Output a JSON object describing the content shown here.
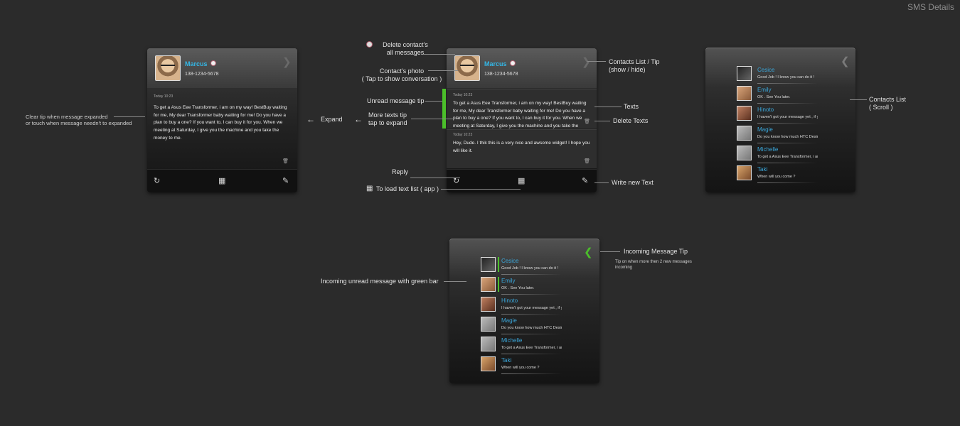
{
  "page_title": "SMS Details",
  "contact": {
    "name": "Marcus",
    "phone": "138-1234-5678"
  },
  "messages": [
    {
      "time": "Today   10:23",
      "text": "To get a Asus Eee Transformer, i am on my way! BestBuy waiting for me, My dear Transformer baby waiting for me! Do you have a plan to buy a one? If you want to, I can buy it for you. When we meeting at Saturday, I give you the machine and you take the money to me."
    },
    {
      "time": "Today   10:23",
      "text": "Hey, Dude. I thik this is a very nice and awsome widget! I hope you will like it."
    }
  ],
  "contacts": [
    {
      "name": "Cesice",
      "preview": "Good Job !  I know you can do it !",
      "unread": true
    },
    {
      "name": "Emily",
      "preview": "OK . See You later.",
      "unread": true
    },
    {
      "name": "Hinoto",
      "preview": "I haven't got your message yet , if you",
      "unread": false
    },
    {
      "name": "Magie",
      "preview": "Do you know how much HTC Desire",
      "unread": false
    },
    {
      "name": "Michelle",
      "preview": "To get a Asus Eee Transformer, i am on",
      "unread": false
    },
    {
      "name": "Taki",
      "preview": "When will you come ?",
      "unread": false
    }
  ],
  "annotations": {
    "clear_tip": "Clear tip when message expanded\nor touch when message needn't to expanded",
    "expand": "Expand",
    "delete_contact": "Delete contact's\nall messages",
    "contact_photo": "Contact's photo\n( Tap to show conversation )",
    "unread_tip": "Unread message tip",
    "more_texts": "More texts tip\ntap to expand",
    "reply": "Reply",
    "load_text_list": "To load text list ( app )",
    "contacts_tip": "Contacts List / Tip\n(show / hide)",
    "texts": "Texts",
    "delete_texts": "Delete Texts",
    "write_new": "Write new Text",
    "contacts_scroll": "Contacts List\n( Scroll )",
    "incoming_tip": "Incoming Message Tip",
    "incoming_tip_sub": "Tip on when more then 2 new messages\nincoming",
    "incoming_unread": "Incoming unread message with green bar"
  },
  "colors": {
    "accent_blue": "#34b7e6",
    "unread_green": "#4bbf2a",
    "background": "#2b2b2b"
  },
  "icons": [
    "reply-icon",
    "grid-icon",
    "pencil-icon",
    "trash-icon",
    "chevron-right-icon",
    "chevron-left-icon"
  ]
}
